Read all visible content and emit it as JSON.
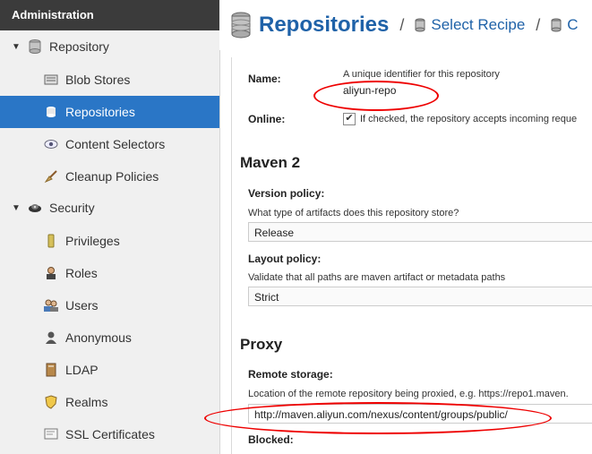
{
  "sidebar": {
    "header": "Administration",
    "items": [
      {
        "label": "Repository",
        "icon": "database-icon",
        "group": true,
        "expanded": true
      },
      {
        "label": "Blob Stores",
        "icon": "server-icon"
      },
      {
        "label": "Repositories",
        "icon": "database-icon",
        "selected": true
      },
      {
        "label": "Content Selectors",
        "icon": "eye-icon"
      },
      {
        "label": "Cleanup Policies",
        "icon": "broom-icon"
      },
      {
        "label": "Security",
        "icon": "security-icon",
        "group": true,
        "expanded": true
      },
      {
        "label": "Privileges",
        "icon": "medal-icon"
      },
      {
        "label": "Roles",
        "icon": "role-icon"
      },
      {
        "label": "Users",
        "icon": "users-icon"
      },
      {
        "label": "Anonymous",
        "icon": "person-icon"
      },
      {
        "label": "LDAP",
        "icon": "book-icon"
      },
      {
        "label": "Realms",
        "icon": "shield-icon"
      },
      {
        "label": "SSL Certificates",
        "icon": "certificate-icon"
      }
    ]
  },
  "header": {
    "title": "Repositories",
    "sep": "/",
    "crumb1": "Select Recipe",
    "crumb2_initial": "C"
  },
  "form": {
    "name_label": "Name:",
    "name_hint": "A unique identifier for this repository",
    "name_value": "aliyun-repo",
    "online_label": "Online:",
    "online_text": "If checked, the repository accepts incoming reque",
    "online_checked": "✔",
    "maven_section": "Maven 2",
    "version_label": "Version policy:",
    "version_hint": "What type of artifacts does this repository store?",
    "version_value": "Release",
    "layout_label": "Layout policy:",
    "layout_hint": "Validate that all paths are maven artifact or metadata paths",
    "layout_value": "Strict",
    "proxy_section": "Proxy",
    "remote_label": "Remote storage:",
    "remote_hint": "Location of the remote repository being proxied, e.g. https://repo1.maven.",
    "remote_value": "http://maven.aliyun.com/nexus/content/groups/public/",
    "blocked_label": "Blocked:"
  },
  "colors": {
    "sidebar_header": "#3b3b3b",
    "selected": "#2a76c6",
    "title": "#1f62a8",
    "annotation": "#e00000"
  }
}
